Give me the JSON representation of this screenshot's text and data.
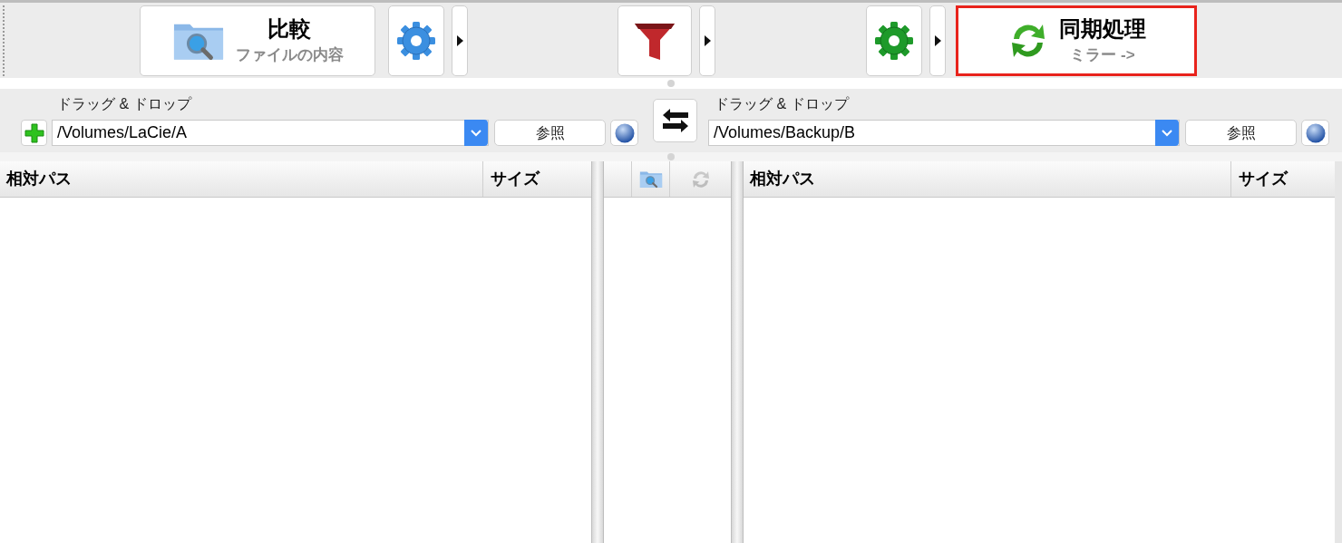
{
  "toolbar": {
    "items": [
      {
        "kind": "compare",
        "title": "比較",
        "subtitle": "ファイルの内容",
        "selected": false
      },
      {
        "kind": "compare-settings"
      },
      {
        "kind": "dropdown"
      },
      {
        "kind": "filter"
      },
      {
        "kind": "dropdown"
      },
      {
        "kind": "sync-settings"
      },
      {
        "kind": "dropdown"
      },
      {
        "kind": "sync",
        "title": "同期処理",
        "subtitle": "ミラー ->",
        "selected": true
      }
    ]
  },
  "folders": {
    "left": {
      "label": "ドラッグ & ドロップ",
      "path": "/Volumes/LaCie/A",
      "browse": "参照"
    },
    "right": {
      "label": "ドラッグ & ドロップ",
      "path": "/Volumes/Backup/B",
      "browse": "参照"
    }
  },
  "left_list": {
    "columns": [
      "相対パス",
      "サイズ"
    ]
  },
  "middle": {
    "buttons": [
      {
        "kind": "compare-view",
        "disabled": false
      },
      {
        "kind": "sync-view",
        "disabled": true
      }
    ]
  },
  "right_list": {
    "columns": [
      "相対パス",
      "サイズ"
    ]
  }
}
